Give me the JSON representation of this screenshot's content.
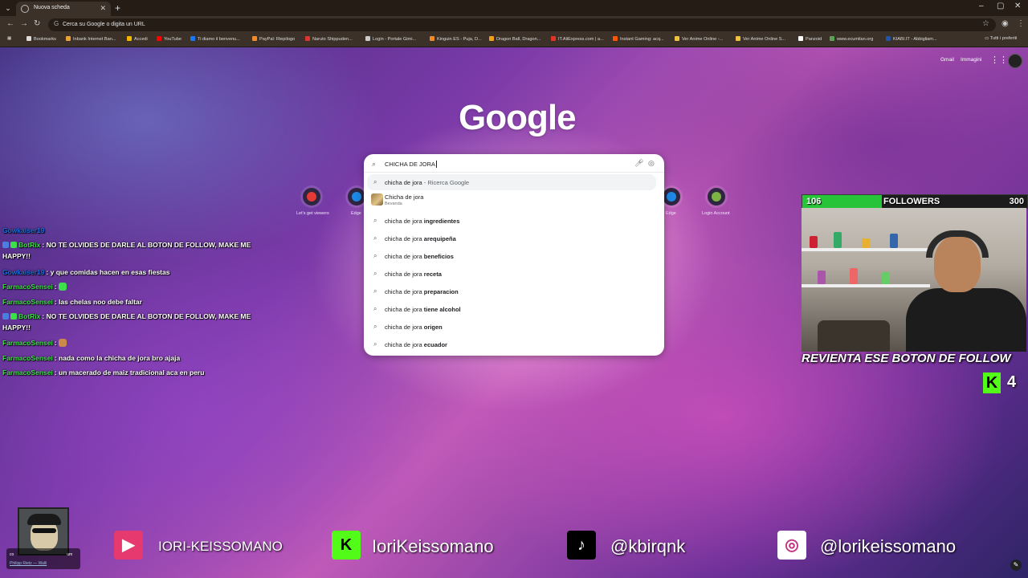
{
  "browser": {
    "tab_title": "Nuova scheda",
    "address_text": "Cerca su Google o digita un URL",
    "bookmarks": [
      {
        "label": "Bookmarks",
        "icon": "star-icon",
        "color": "#dddddd"
      },
      {
        "label": "Inbank Internet Ban...",
        "icon": "inbank-icon",
        "color": "#e8a23a"
      },
      {
        "label": "Accedi",
        "icon": "grid-icon",
        "color": "#f4b400"
      },
      {
        "label": "YouTube",
        "icon": "youtube-icon",
        "color": "#ff0000"
      },
      {
        "label": "Ti diamo il benvenu...",
        "icon": "facebook-icon",
        "color": "#1877f2"
      },
      {
        "label": "PayPal: Riepilogo",
        "icon": "paypal-icon",
        "color": "#f08a2a"
      },
      {
        "label": "Naruto Shippuden...",
        "icon": "naruto-icon",
        "color": "#d33"
      },
      {
        "label": "Login - Portale Gimi...",
        "icon": "page-icon",
        "color": "#cccccc"
      },
      {
        "label": "Kinguin ES - Puja, D...",
        "icon": "kinguin-icon",
        "color": "#f08a2a"
      },
      {
        "label": "Dragon Ball, Dragon...",
        "icon": "dragonball-icon",
        "color": "#f0a020"
      },
      {
        "label": "IT.AliExpress.com | a...",
        "icon": "aliexpress-icon",
        "color": "#e43225"
      },
      {
        "label": "Instant Gaming: acq...",
        "icon": "instantgaming-icon",
        "color": "#ff5400"
      },
      {
        "label": "Ver Anime Online -...",
        "icon": "anime-icon",
        "color": "#f0c040"
      },
      {
        "label": "Ver Anime Online S...",
        "icon": "anime-icon",
        "color": "#f0c040"
      },
      {
        "label": "Panzoid",
        "icon": "panzoid-icon",
        "color": "#ffffff"
      },
      {
        "label": "www.ecumilan.org",
        "icon": "ecumilan-icon",
        "color": "#5aa05a"
      },
      {
        "label": "KIABI.IT - Abbigliam...",
        "icon": "kiabi-icon",
        "color": "#2255aa"
      }
    ],
    "other_bookmarks": "Tutti i preferiti"
  },
  "ntp": {
    "gmail": "Gmail",
    "images": "Immagini",
    "logo": "Google",
    "shortcuts": [
      {
        "label": "Let's get viewers",
        "icon": "youtube-shortcut-icon",
        "color": "#e53935"
      },
      {
        "label": "Edge",
        "icon": "edge-shortcut-icon",
        "color": "#1e88e5"
      },
      {
        "label": "Edge",
        "icon": "edge-shortcut-icon",
        "color": "#1e88e5"
      },
      {
        "label": "Login Account",
        "icon": "panzoid-shortcut-icon",
        "color": "#7cb342"
      }
    ]
  },
  "search": {
    "query": "CHICHA DE JORA",
    "suggestions": [
      {
        "prefix": "chicha de jora",
        "rest": "",
        "note": " - Ricerca Google"
      },
      {
        "prefix": "Chicha de jora",
        "rest": "",
        "note": "",
        "subtitle": "Bevanda"
      },
      {
        "prefix": "chicha de jora",
        "rest": " ingredientes",
        "note": ""
      },
      {
        "prefix": "chicha de jora",
        "rest": " arequipeña",
        "note": ""
      },
      {
        "prefix": "chicha de jora",
        "rest": " beneficios",
        "note": ""
      },
      {
        "prefix": "chicha de jora",
        "rest": " receta",
        "note": ""
      },
      {
        "prefix": "chicha de jora",
        "rest": " preparacion",
        "note": ""
      },
      {
        "prefix": "chicha de jora",
        "rest": " tiene alcohol",
        "note": ""
      },
      {
        "prefix": "chicha de jora",
        "rest": " origen",
        "note": ""
      },
      {
        "prefix": "chicha de jora",
        "rest": " ecuador",
        "note": ""
      }
    ]
  },
  "chat": [
    {
      "user": "Gowkaiser19",
      "user_color": "#1e6fd8",
      "text": "",
      "badges": 0
    },
    {
      "user": "BotRix",
      "user_color": "#3de04a",
      "text": ": NO TE OLVIDES DE DARLE AL BOTON DE FOLLOW, MAKE ME HAPPY!!",
      "badges": 2
    },
    {
      "user": "Gowkaiser19",
      "user_color": "#1e6fd8",
      "text": ": y que comidas hacen en esas fiestas",
      "badges": 0
    },
    {
      "user": "FarmacoSensei",
      "user_color": "#3de04a",
      "text": ":",
      "badges": 0
    },
    {
      "user": "FarmacoSensei",
      "user_color": "#3de04a",
      "text": ": las chelas noo debe faltar",
      "badges": 0
    },
    {
      "user": "BotRix",
      "user_color": "#3de04a",
      "text": ": NO TE OLVIDES DE DARLE AL BOTON DE FOLLOW, MAKE ME HAPPY!!",
      "badges": 2
    },
    {
      "user": "FarmacoSensei",
      "user_color": "#3de04a",
      "text": ":",
      "badges": 0
    },
    {
      "user": "FarmacoSensei",
      "user_color": "#3de04a",
      "text": ": nada como la chicha de jora bro ajaja",
      "badges": 0
    },
    {
      "user": "FarmacoSensei",
      "user_color": "#3de04a",
      "text": ": un macerado de maiz tradicional aca en peru",
      "badges": 0
    }
  ],
  "followers": {
    "current": "106",
    "label": "FOLLOWERS",
    "goal": "300",
    "progress": 0.353,
    "banner": "REVIENTA ESE BOTON DE FOLLOW",
    "kick_viewers": "4"
  },
  "socials": [
    {
      "platform": "youtube",
      "icon": "youtube-icon",
      "handle": "IORI-KEISSOMANO",
      "color": "#e53970"
    },
    {
      "platform": "kick",
      "icon": "kick-icon",
      "handle": "IoriKeissomano",
      "color": "#53fc18"
    },
    {
      "platform": "tiktok",
      "icon": "tiktok-icon",
      "handle": "@kbirqnk",
      "color": "#000000"
    },
    {
      "platform": "instagram",
      "icon": "instagram-icon",
      "handle": "@lorikeissomano",
      "color": "#ffffff"
    }
  ],
  "now_playing": {
    "song_prefix": "co",
    "song_suffix": "um",
    "artist": "Philipp Rietz — Walli"
  }
}
